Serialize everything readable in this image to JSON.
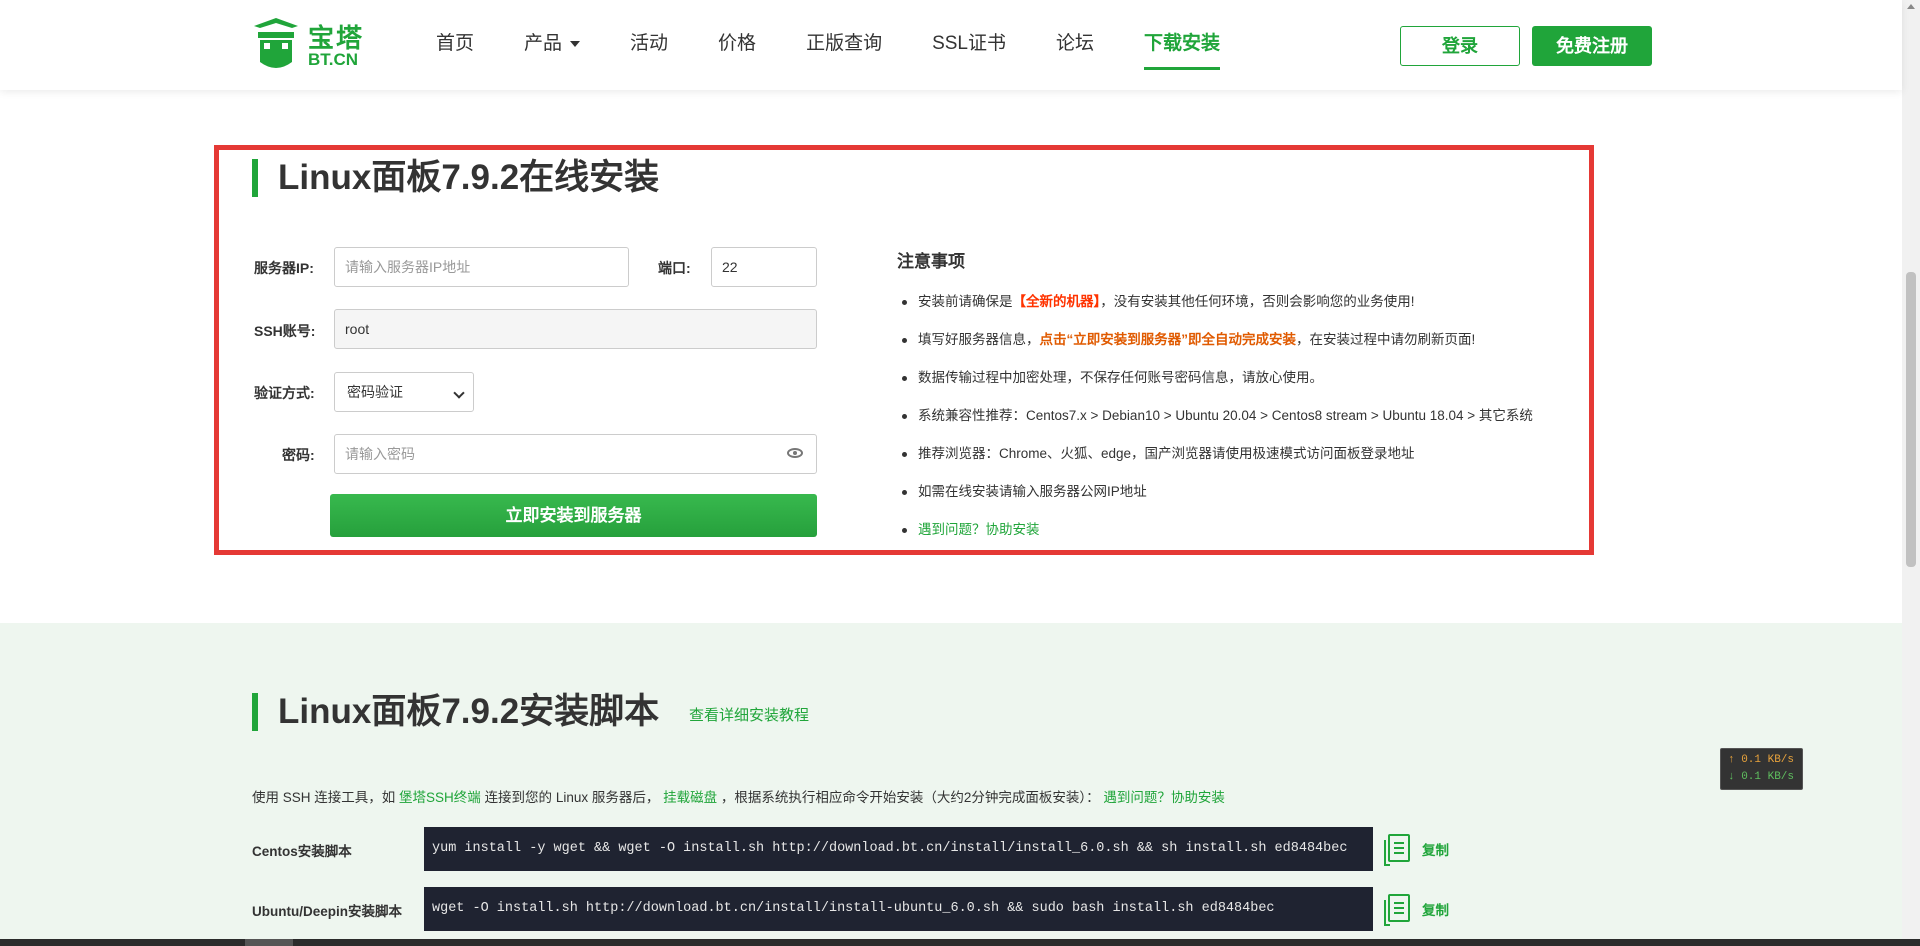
{
  "header": {
    "logo_cn": "宝塔",
    "logo_en": "BT.CN",
    "nav": [
      "首页",
      "产品",
      "活动",
      "价格",
      "正版查询",
      "SSL证书",
      "论坛",
      "下载安装"
    ],
    "login": "登录",
    "register": "免费注册"
  },
  "online_install": {
    "title": "Linux面板7.9.2在线安装",
    "server_ip_label": "服务器IP:",
    "server_ip_placeholder": "请输入服务器IP地址",
    "port_label": "端口:",
    "port_value": "22",
    "ssh_label": "SSH账号:",
    "ssh_value": "root",
    "auth_label": "验证方式:",
    "auth_value": "密码验证",
    "password_label": "密码:",
    "password_placeholder": "请输入密码",
    "install_button": "立即安装到服务器",
    "notes_title": "注意事项",
    "notes": {
      "n1_a": "安装前请确保是",
      "n1_b": "【全新的机器】",
      "n1_c": "，没有安装其他任何环境，否则会影响您的业务使用!",
      "n2_a": "填写好服务器信息，",
      "n2_b": "点击“立即安装到服务器”即全自动完成安装",
      "n2_c": "，在安装过程中请勿刷新页面!",
      "n3": "数据传输过程中加密处理，不保存任何账号密码信息，请放心使用。",
      "n4": "系统兼容性推荐：Centos7.x > Debian10 > Ubuntu 20.04 > Centos8 stream > Ubuntu 18.04 > 其它系统",
      "n5": "推荐浏览器：Chrome、火狐、edge，国产浏览器请使用极速模式访问面板登录地址",
      "n6": "如需在线安装请输入服务器公网IP地址",
      "n7": "遇到问题？协助安装"
    }
  },
  "script_section": {
    "title": "Linux面板7.9.2安装脚本",
    "tutorial_link": "查看详细安装教程",
    "desc_a": "使用 SSH 连接工具，如",
    "desc_link1": "堡塔SSH终端",
    "desc_b": "连接到您的 Linux 服务器后，",
    "desc_link2": "挂载磁盘",
    "desc_c": "，根据系统执行相应命令开始安装（大约2分钟完成面板安装）：",
    "desc_link3": "遇到问题？协助安装",
    "centos_label": "Centos安装脚本",
    "centos_cmd": "yum install -y wget && wget -O install.sh http://download.bt.cn/install/install_6.0.sh && sh install.sh ed8484bec",
    "ubuntu_label": "Ubuntu/Deepin安装脚本",
    "ubuntu_cmd": "wget -O install.sh http://download.bt.cn/install/install-ubuntu_6.0.sh && sudo bash install.sh ed8484bec",
    "copy": "复制"
  },
  "speed": {
    "up": "↑ 0.1 KB/s",
    "down": "↓ 0.1 KB/s"
  },
  "colors": {
    "brand_green": "#20a53a",
    "highlight_red": "#e53935",
    "code_bg": "#1f2331"
  }
}
